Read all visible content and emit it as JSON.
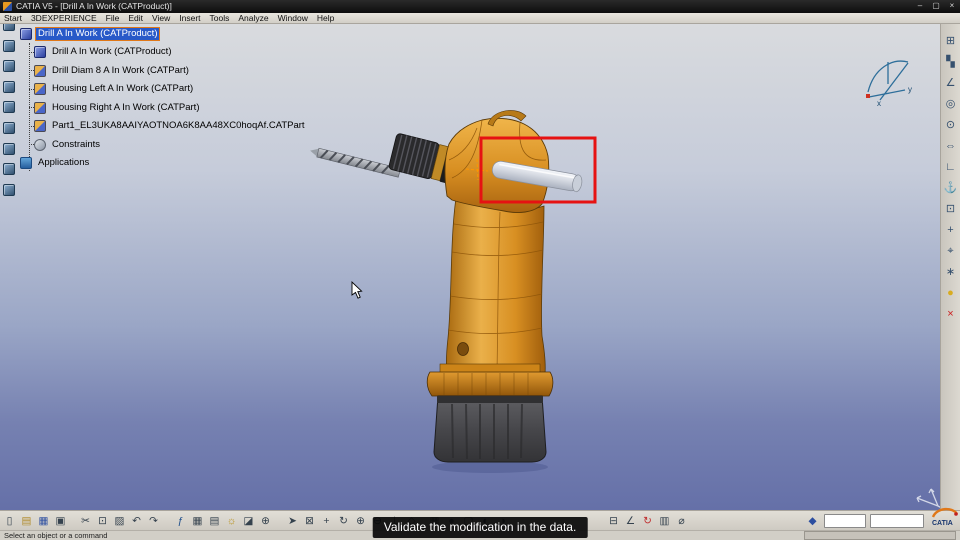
{
  "window": {
    "title": "CATIA V5 - [Drill A In Work (CATProduct)]",
    "controls": {
      "minimize": "–",
      "maximize": "▢",
      "close": "×"
    }
  },
  "menubar": {
    "items": [
      {
        "name": "menu-start",
        "label": "Start"
      },
      {
        "name": "menu-3dexperience",
        "label": "3DEXPERIENCE"
      },
      {
        "name": "menu-file",
        "label": "File"
      },
      {
        "name": "menu-edit",
        "label": "Edit"
      },
      {
        "name": "menu-view",
        "label": "View"
      },
      {
        "name": "menu-insert",
        "label": "Insert"
      },
      {
        "name": "menu-tools",
        "label": "Tools"
      },
      {
        "name": "menu-analyze",
        "label": "Analyze"
      },
      {
        "name": "menu-window",
        "label": "Window"
      },
      {
        "name": "menu-help",
        "label": "Help"
      }
    ]
  },
  "tree": {
    "items": [
      {
        "label": "Drill A In Work (CATProduct)",
        "type": "product",
        "selected": true,
        "indent": 0
      },
      {
        "label": "Drill A In Work (CATProduct)",
        "type": "product",
        "selected": false,
        "indent": 1
      },
      {
        "label": "Drill Diam 8 A In Work (CATPart)",
        "type": "part",
        "selected": false,
        "indent": 1
      },
      {
        "label": "Housing Left A In Work (CATPart)",
        "type": "part",
        "selected": false,
        "indent": 1
      },
      {
        "label": "Housing Right A In Work (CATPart)",
        "type": "part",
        "selected": false,
        "indent": 1
      },
      {
        "label": "Part1_EL3UKA8AAIYAOTNOA6K8AA48XC0hoqAf.CATPart",
        "type": "part",
        "selected": false,
        "indent": 1
      },
      {
        "label": "Constraints",
        "type": "constraints",
        "selected": false,
        "indent": 1
      },
      {
        "label": "Applications",
        "type": "applications",
        "selected": false,
        "indent": 0
      }
    ],
    "edge_anchors": [
      {
        "name": "tree-anchor-icon"
      },
      {
        "name": "tree-anchor-icon"
      },
      {
        "name": "tree-anchor-icon"
      },
      {
        "name": "tree-anchor-icon"
      },
      {
        "name": "tree-anchor-icon"
      },
      {
        "name": "tree-anchor-icon"
      },
      {
        "name": "tree-anchor-icon"
      },
      {
        "name": "tree-anchor-icon"
      },
      {
        "name": "tree-anchor-icon"
      }
    ]
  },
  "viewport": {
    "compass": {
      "x": "x",
      "y": "y"
    },
    "highlight_color": "#e61212"
  },
  "toolbars": {
    "right": [
      {
        "name": "product-structure-tools-icon",
        "glyph": "⊞"
      },
      {
        "name": "component-icon",
        "glyph": "▚"
      },
      {
        "name": "constraints-toolbar-icon",
        "glyph": "∠"
      },
      {
        "name": "coincidence-constraint-icon",
        "glyph": "◎"
      },
      {
        "name": "contact-constraint-icon",
        "glyph": "⊙"
      },
      {
        "name": "offset-constraint-icon",
        "glyph": "⇔"
      },
      {
        "name": "angle-constraint-icon",
        "glyph": "∟"
      },
      {
        "name": "anchor-constraint-icon",
        "glyph": "⚓"
      },
      {
        "name": "fix-together-icon",
        "glyph": "⊡"
      },
      {
        "name": "manipulate-icon",
        "glyph": "+"
      },
      {
        "name": "snap-icon",
        "glyph": "⌖"
      },
      {
        "name": "explode-icon",
        "glyph": "∗"
      },
      {
        "name": "smart-move-icon",
        "glyph": "●",
        "color": "#d8ac20"
      },
      {
        "name": "stop-update-icon",
        "glyph": "×",
        "color": "#cc2020"
      }
    ],
    "bottom_file": [
      {
        "name": "new-document-icon",
        "glyph": "▯"
      },
      {
        "name": "open-folder-icon",
        "glyph": "▤",
        "color": "#b08a28"
      },
      {
        "name": "save-icon",
        "glyph": "▦",
        "color": "#2c4ea0"
      },
      {
        "name": "print-icon",
        "glyph": "▣"
      }
    ],
    "bottom_edit": [
      {
        "name": "cut-icon",
        "glyph": "✂"
      },
      {
        "name": "copy-icon",
        "glyph": "⊡"
      },
      {
        "name": "paste-icon",
        "glyph": "▨"
      },
      {
        "name": "undo-icon",
        "glyph": "↶"
      },
      {
        "name": "redo-icon",
        "glyph": "↷"
      }
    ],
    "bottom_knowledge": [
      {
        "name": "formula-icon",
        "glyph": "ƒ",
        "color": "#20508c"
      },
      {
        "name": "design-table-icon",
        "glyph": "▦"
      },
      {
        "name": "catalog-icon",
        "glyph": "▤"
      },
      {
        "name": "light-icon",
        "glyph": "☼",
        "color": "#b89016"
      },
      {
        "name": "depth-effect-icon",
        "glyph": "◪"
      },
      {
        "name": "magnifier-icon",
        "glyph": "⊕"
      }
    ],
    "bottom_view": [
      {
        "name": "fly-mode-icon",
        "glyph": "➤"
      },
      {
        "name": "fit-all-in-icon",
        "glyph": "⊠"
      },
      {
        "name": "pan-icon",
        "glyph": "+"
      },
      {
        "name": "rotate-icon",
        "glyph": "↻"
      },
      {
        "name": "zoom-in-icon",
        "glyph": "⊕"
      },
      {
        "name": "zoom-out-icon",
        "glyph": "⊖"
      },
      {
        "name": "normal-view-icon",
        "glyph": "⊥"
      },
      {
        "name": "isometric-view-icon",
        "glyph": "◇"
      }
    ],
    "bottom_render": [
      {
        "name": "multi-view-icon",
        "glyph": "▦"
      },
      {
        "name": "shading-icon",
        "glyph": "●",
        "color": "#5c6a7a"
      },
      {
        "name": "wireframe-icon",
        "glyph": "▢"
      },
      {
        "name": "hide-show-icon",
        "glyph": "◐"
      },
      {
        "name": "swap-visible-space-icon",
        "glyph": "◑"
      }
    ],
    "bottom_right": [
      {
        "name": "graph-list-icon",
        "glyph": "⊟"
      },
      {
        "name": "constraint-creation-icon",
        "glyph": "∠"
      },
      {
        "name": "update-all-icon",
        "glyph": "↻",
        "color": "#c03030"
      },
      {
        "name": "catalog-browser-icon",
        "glyph": "▥"
      },
      {
        "name": "measure-icon",
        "glyph": "⌀"
      }
    ],
    "bottom_power": [
      {
        "name": "active-workbench-icon",
        "glyph": "◆",
        "color": "#2c4ea0"
      }
    ]
  },
  "subtitle": {
    "text": "Validate the modification in the data."
  },
  "statusbar": {
    "message": "Select an object or a command"
  },
  "logo": {
    "text": "CATIA"
  },
  "colors": {
    "selection_blue": "#2859c8",
    "selection_border": "#e07818",
    "highlight_red": "#e61212",
    "body_orange": "#d88f22"
  }
}
